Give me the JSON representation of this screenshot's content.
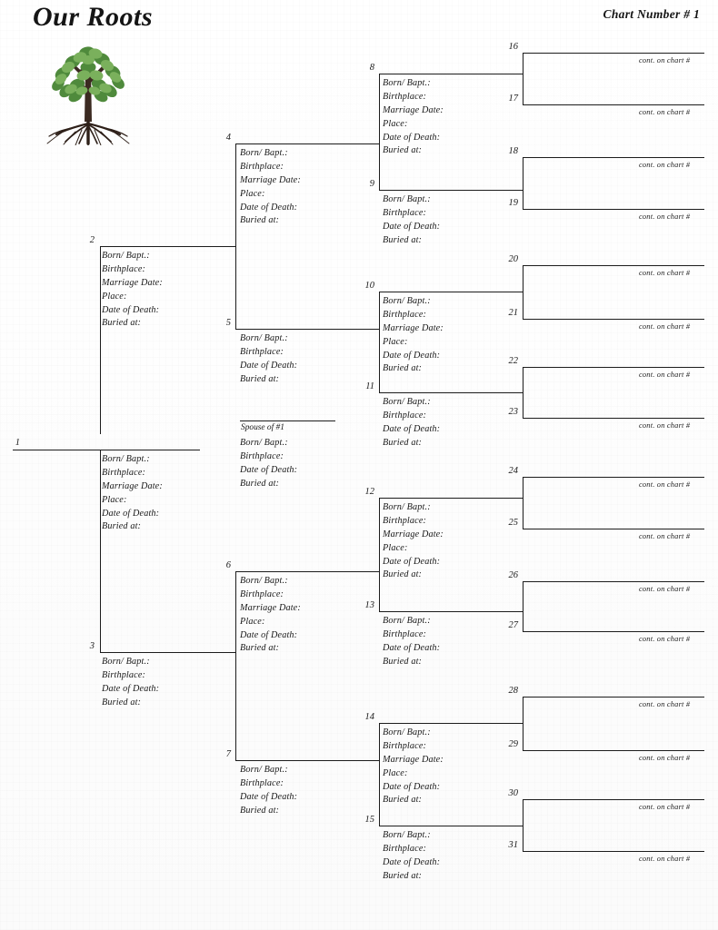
{
  "header": {
    "title": "Our Roots",
    "chart_number": "Chart Number # 1",
    "logo_icon": "family-tree-icon"
  },
  "labels": {
    "born": "Born/ Bapt.:",
    "birthplace": "Birthplace:",
    "marriage_date": "Marriage Date:",
    "place": "Place:",
    "date_of_death": "Date of Death:",
    "buried_at": "Buried at:",
    "cont_on_chart": "cont. on chart #",
    "spouse_of_1": "Spouse of #1"
  },
  "colors": {
    "ink": "#1c1c1c",
    "paper": "#fefefe",
    "leaf_dark": "#4f8a3c",
    "leaf_light": "#7ab05c",
    "trunk": "#3b2a21"
  },
  "persons": [
    {
      "id": "1",
      "num": "1",
      "fields": [
        "Born/ Bapt.:",
        "Birthplace:",
        "Marriage Date:",
        "Place:",
        "Date of Death:",
        "Buried at:"
      ]
    },
    {
      "id": "2",
      "num": "2",
      "fields": [
        "Born/ Bapt.:",
        "Birthplace:",
        "Marriage Date:",
        "Place:",
        "Date of Death:",
        "Buried at:"
      ]
    },
    {
      "id": "3",
      "num": "3",
      "fields": [
        "Born/ Bapt.:",
        "Birthplace:",
        "Date of Death:",
        "Buried at:"
      ]
    },
    {
      "id": "4",
      "num": "4",
      "fields": [
        "Born/ Bapt.:",
        "Birthplace:",
        "Marriage Date:",
        "Place:",
        "Date of Death:",
        "Buried at:"
      ]
    },
    {
      "id": "5",
      "num": "5",
      "fields": [
        "Born/ Bapt.:",
        "Birthplace:",
        "Date of Death:",
        "Buried at:"
      ]
    },
    {
      "id": "6",
      "num": "6",
      "fields": [
        "Born/ Bapt.:",
        "Birthplace:",
        "Marriage Date:",
        "Place:",
        "Date of Death:",
        "Buried at:"
      ]
    },
    {
      "id": "7",
      "num": "7",
      "fields": [
        "Born/ Bapt.:",
        "Birthplace:",
        "Date of Death:",
        "Buried at:"
      ]
    },
    {
      "id": "8",
      "num": "8",
      "fields": [
        "Born/ Bapt.:",
        "Birthplace:",
        "Marriage Date:",
        "Place:",
        "Date of Death:",
        "Buried at:"
      ]
    },
    {
      "id": "9",
      "num": "9",
      "fields": [
        "Born/ Bapt.:",
        "Birthplace:",
        "Date of Death:",
        "Buried at:"
      ]
    },
    {
      "id": "10",
      "num": "10",
      "fields": [
        "Born/ Bapt.:",
        "Birthplace:",
        "Marriage Date:",
        "Place:",
        "Date of Death:",
        "Buried at:"
      ]
    },
    {
      "id": "11",
      "num": "11",
      "fields": [
        "Born/ Bapt.:",
        "Birthplace:",
        "Date of Death:",
        "Buried at:"
      ]
    },
    {
      "id": "12",
      "num": "12",
      "fields": [
        "Born/ Bapt.:",
        "Birthplace:",
        "Marriage Date:",
        "Place:",
        "Date of Death:",
        "Buried at:"
      ]
    },
    {
      "id": "13",
      "num": "13",
      "fields": [
        "Born/ Bapt.:",
        "Birthplace:",
        "Date of Death:",
        "Buried at:"
      ]
    },
    {
      "id": "14",
      "num": "14",
      "fields": [
        "Born/ Bapt.:",
        "Birthplace:",
        "Marriage Date:",
        "Place:",
        "Date of Death:",
        "Buried at:"
      ]
    },
    {
      "id": "15",
      "num": "15",
      "fields": [
        "Born/ Bapt.:",
        "Birthplace:",
        "Date of Death:",
        "Buried at:"
      ]
    }
  ],
  "spouse": {
    "label": "Spouse of #1",
    "fields": [
      "Born/ Bapt.:",
      "Birthplace:",
      "Date of Death:",
      "Buried at:"
    ]
  },
  "continuations": [
    {
      "num": "16",
      "text": "cont. on chart #"
    },
    {
      "num": "17",
      "text": "cont. on chart #"
    },
    {
      "num": "18",
      "text": "cont. on chart #"
    },
    {
      "num": "19",
      "text": "cont. on chart #"
    },
    {
      "num": "20",
      "text": "cont. on chart #"
    },
    {
      "num": "21",
      "text": "cont. on chart #"
    },
    {
      "num": "22",
      "text": "cont. on chart #"
    },
    {
      "num": "23",
      "text": "cont. on chart #"
    },
    {
      "num": "24",
      "text": "cont. on chart #"
    },
    {
      "num": "25",
      "text": "cont. on chart #"
    },
    {
      "num": "26",
      "text": "cont. on chart #"
    },
    {
      "num": "27",
      "text": "cont. on chart #"
    },
    {
      "num": "28",
      "text": "cont. on chart #"
    },
    {
      "num": "29",
      "text": "cont. on chart #"
    },
    {
      "num": "30",
      "text": "cont. on chart #"
    },
    {
      "num": "31",
      "text": "cont. on chart #"
    }
  ]
}
